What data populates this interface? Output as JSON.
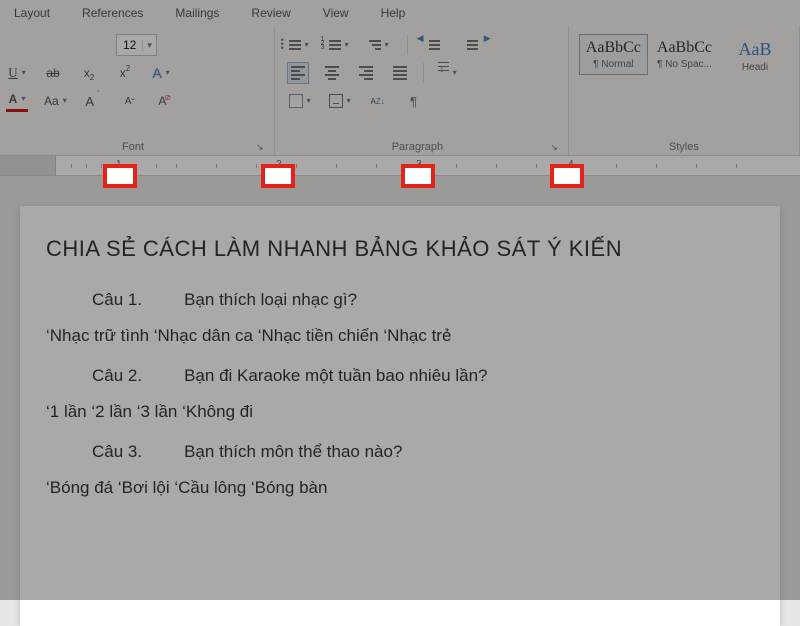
{
  "tabs": [
    "Layout",
    "References",
    "Mailings",
    "Review",
    "View",
    "Help"
  ],
  "font": {
    "group_label": "Font",
    "size": "12",
    "underline": "U",
    "strike": "ab",
    "subscript": "x2",
    "superscript": "x2",
    "clearfmt": "A",
    "fontcolor": "A",
    "changecase": "Aa",
    "grow": "A",
    "shrink": "A"
  },
  "paragraph": {
    "group_label": "Paragraph"
  },
  "styles": {
    "group_label": "Styles",
    "items": [
      {
        "preview": "AaBbCc",
        "name": "¶ Normal",
        "selected": true
      },
      {
        "preview": "AaBbCc",
        "name": "¶ No Spac...",
        "selected": false
      },
      {
        "preview": "AaB",
        "name": "Headi",
        "selected": false
      }
    ]
  },
  "ruler": {
    "marks": [
      "1",
      "2",
      "3",
      "4"
    ]
  },
  "document": {
    "title": "CHIA SẺ CÁCH LÀM NHANH BẢNG KHẢO SÁT Ý KIẾN",
    "questions": [
      {
        "label": "Câu 1.",
        "text": "Bạn thích loại nhạc gì?",
        "answers": "‘Nhạc trữ tình ‘Nhạc dân ca ‘Nhạc tiền chiến ‘Nhạc trẻ"
      },
      {
        "label": "Câu 2.",
        "text": "Bạn đi Karaoke một tuần bao nhiêu lần?",
        "answers": "‘1 lần ‘2 lần ‘3 lần ‘Không đi"
      },
      {
        "label": "Câu 3.",
        "text": "Bạn thích môn thể thao nào?",
        "answers": "‘Bóng đá ‘Bơi lội ‘Cầu lông ‘Bóng bàn"
      }
    ]
  }
}
